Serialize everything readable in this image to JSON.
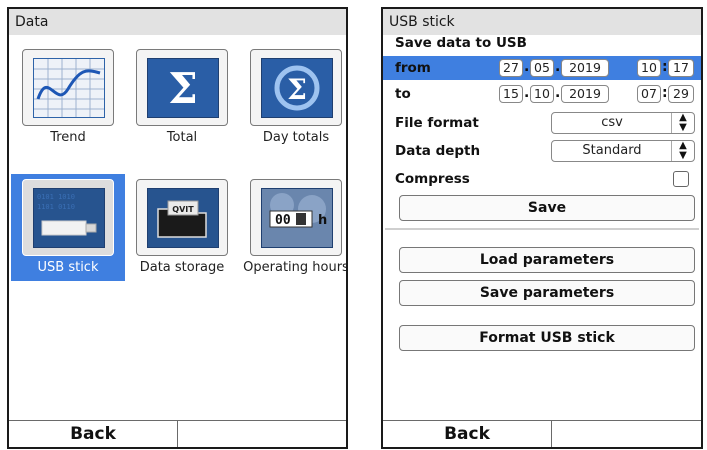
{
  "left": {
    "title": "Data",
    "tiles": [
      {
        "label": "Trend",
        "icon": "trend-chart-icon"
      },
      {
        "label": "Total",
        "icon": "sigma-icon"
      },
      {
        "label": "Day totals",
        "icon": "day-totals-sigma-icon"
      },
      {
        "label": "USB stick",
        "icon": "usb-stick-icon",
        "selected": true
      },
      {
        "label": "Data storage",
        "icon": "data-storage-folder-icon"
      },
      {
        "label": "Operating hours",
        "icon": "hour-counter-icon"
      }
    ],
    "counter_text": "00",
    "counter_unit": "h",
    "folder_tag": "QVIT",
    "back": "Back"
  },
  "right": {
    "title": "USB stick",
    "heading": "Save data to USB",
    "from": {
      "label": "from",
      "day": "27",
      "month": "05",
      "year": "2019",
      "hour": "10",
      "minute": "17"
    },
    "to": {
      "label": "to",
      "day": "15",
      "month": "10",
      "year": "2019",
      "hour": "07",
      "minute": "29"
    },
    "file_format": {
      "label": "File format",
      "value": "csv"
    },
    "data_depth": {
      "label": "Data depth",
      "value": "Standard"
    },
    "compress": {
      "label": "Compress"
    },
    "save": "Save",
    "load_parameters": "Load parameters",
    "save_parameters": "Save parameters",
    "format_usb": "Format USB stick",
    "back": "Back"
  },
  "colors": {
    "accent": "#3f7fe0",
    "icon_blue": "#2e63a8",
    "title_bar": "#e2e2e2"
  }
}
